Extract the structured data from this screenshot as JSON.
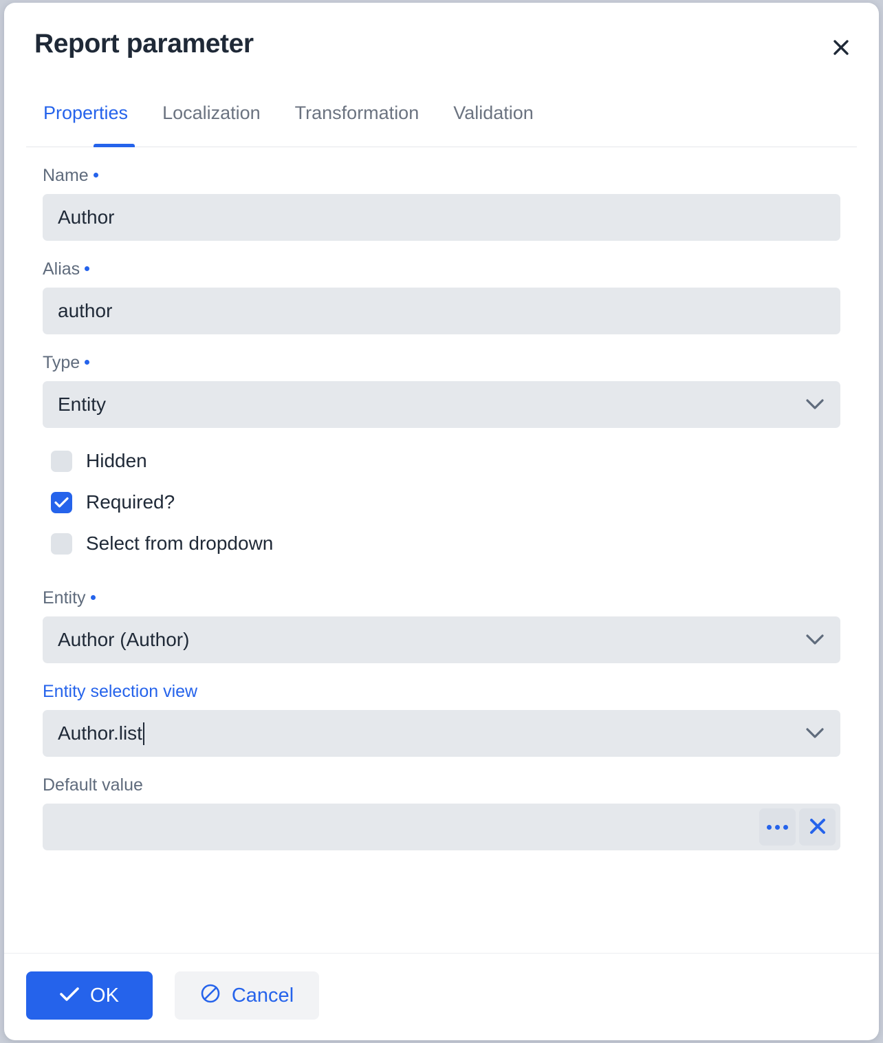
{
  "dialog": {
    "title": "Report parameter",
    "close_icon": "close-icon"
  },
  "tabs": [
    {
      "label": "Properties",
      "active": true
    },
    {
      "label": "Localization",
      "active": false
    },
    {
      "label": "Transformation",
      "active": false
    },
    {
      "label": "Validation",
      "active": false
    }
  ],
  "fields": {
    "name": {
      "label": "Name",
      "required": true,
      "value": "Author"
    },
    "alias": {
      "label": "Alias",
      "required": true,
      "value": "author"
    },
    "type": {
      "label": "Type",
      "required": true,
      "value": "Entity",
      "icon": "chevron-down-icon"
    },
    "entity": {
      "label": "Entity",
      "required": true,
      "value": "Author (Author)",
      "icon": "chevron-down-icon"
    },
    "entity_selection_view": {
      "label": "Entity selection view",
      "required": false,
      "value": "Author.list",
      "icon": "chevron-down-icon"
    },
    "default_value": {
      "label": "Default value",
      "value": "",
      "browse_icon": "ellipsis-icon",
      "clear_icon": "clear-x-icon"
    }
  },
  "checkboxes": [
    {
      "label": "Hidden",
      "checked": false
    },
    {
      "label": "Required?",
      "checked": true
    },
    {
      "label": "Select from dropdown",
      "checked": false
    }
  ],
  "footer": {
    "ok_label": "OK",
    "ok_icon": "check-icon",
    "cancel_label": "Cancel",
    "cancel_icon": "ban-icon"
  },
  "colors": {
    "accent": "#2563eb",
    "input_bg": "#e5e8ec",
    "label": "#5f6b7c",
    "text": "#1f2937",
    "tab_inactive": "#6b7380"
  }
}
